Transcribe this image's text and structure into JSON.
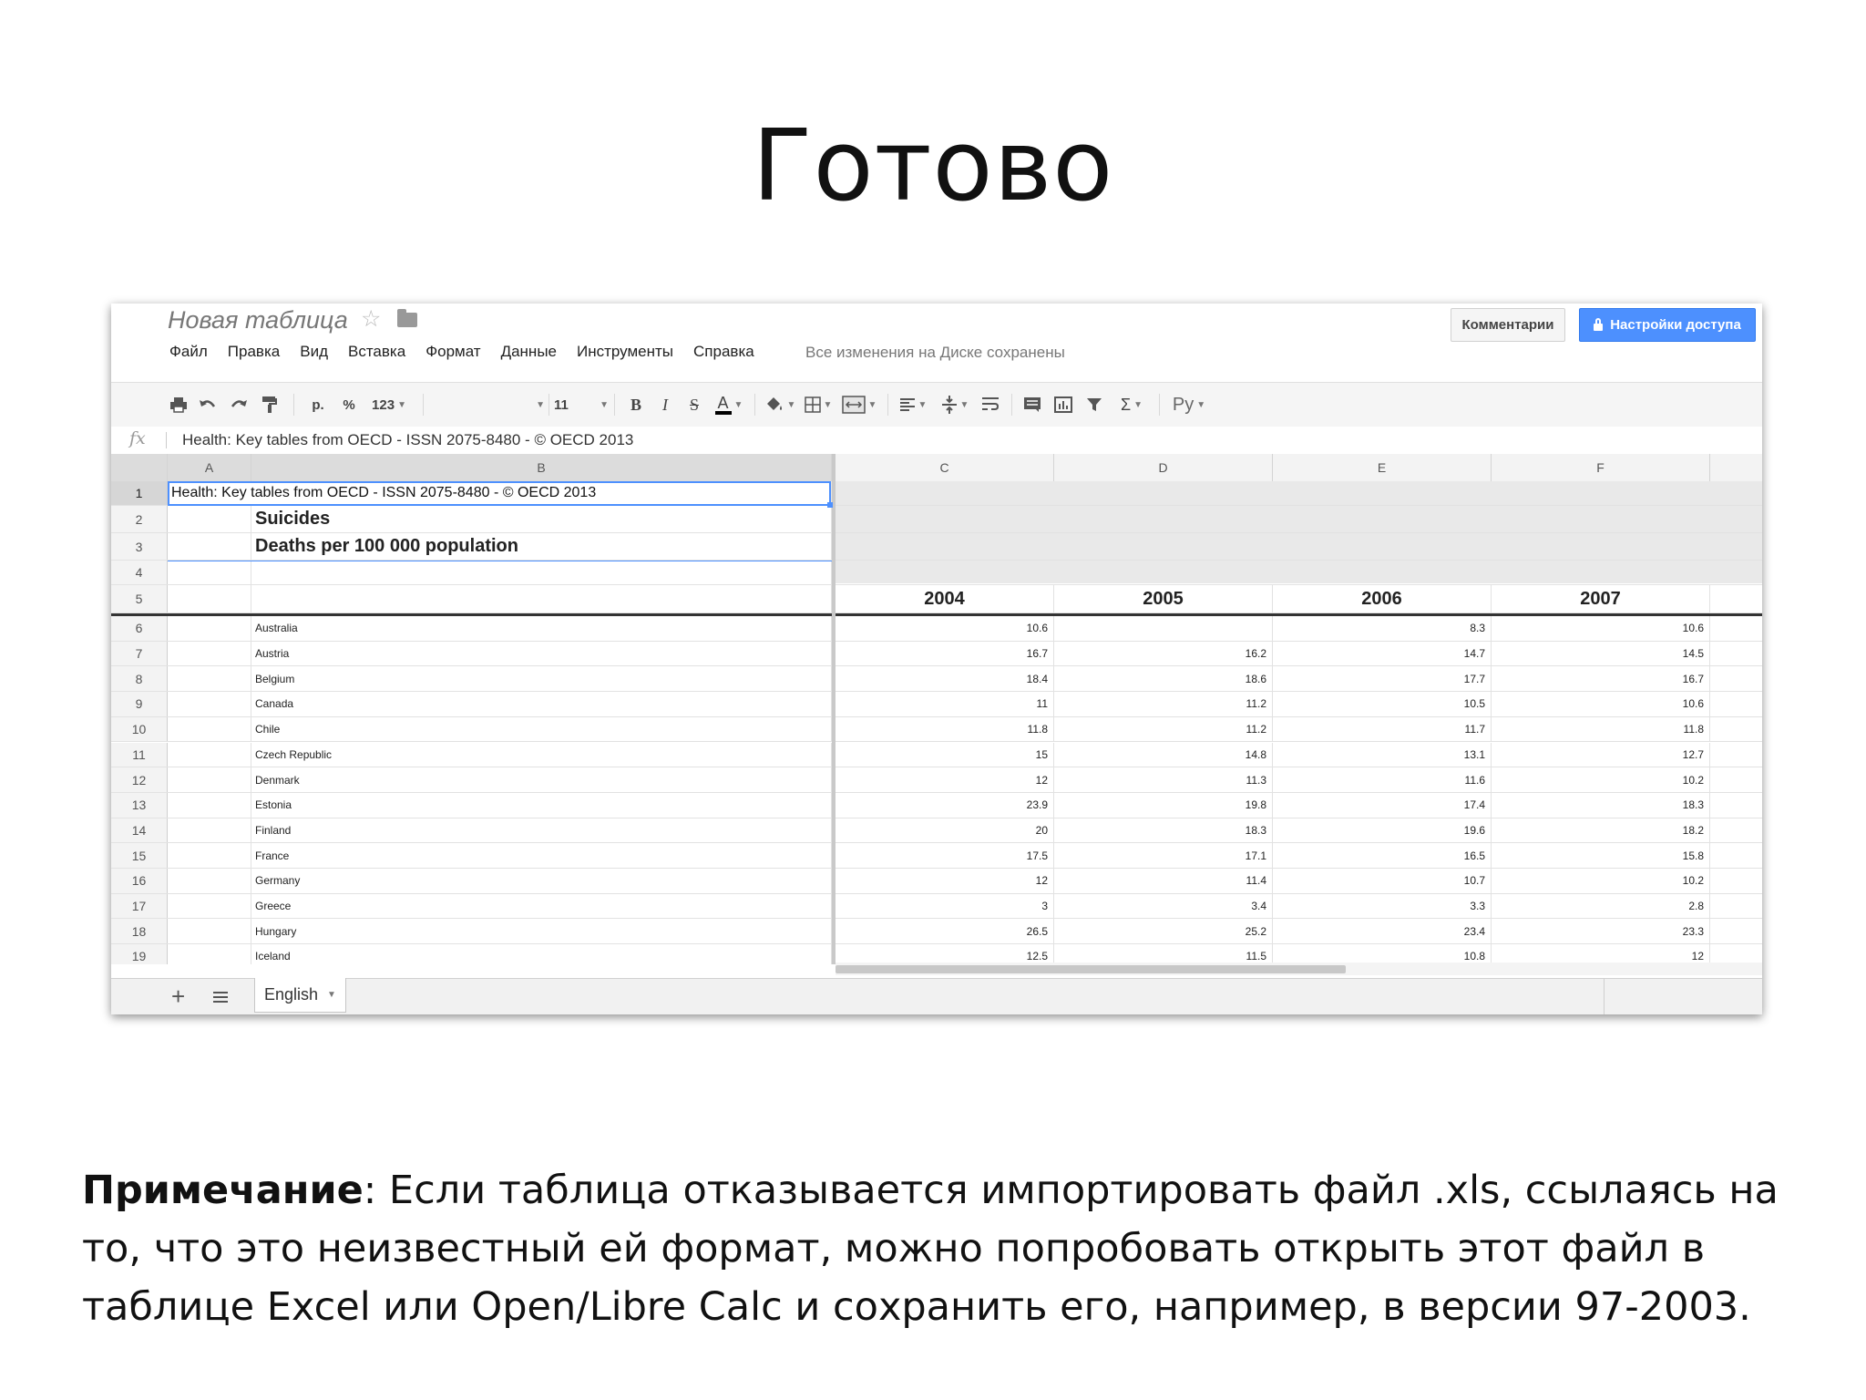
{
  "slide": {
    "title": "Готово",
    "note_label": "Примечание",
    "note_text": ": Если таблица отказывается импортировать файл .xls, ссылаясь на то, что это неизвестный ей формат, можно попробовать открыть этот файл в таблице Excel или Open/Libre Calc и сохранить его, например, в версии 97-2003."
  },
  "app": {
    "doc_title": "Новая таблица",
    "menu": [
      "Файл",
      "Правка",
      "Вид",
      "Вставка",
      "Формат",
      "Данные",
      "Инструменты",
      "Справка"
    ],
    "saved_status": "Все изменения на Диске сохранены",
    "comments_label": "Комментарии",
    "share_label": "Настройки доступа",
    "accent_color": "#4d90fe"
  },
  "toolbar": {
    "currency_label": "р.",
    "percent_label": "%",
    "number_format_label": "123",
    "font_size": "11",
    "bold_label": "B",
    "italic_label": "I",
    "strike_label": "S",
    "text_color_label": "A",
    "input_tools_label": "Ру",
    "sum_label": "Σ"
  },
  "formula_bar": {
    "fx_label": "fx",
    "content": "Health: Key tables from OECD - ISSN 2075-8480 - © OECD 2013"
  },
  "grid": {
    "columns": [
      "A",
      "B",
      "C",
      "D",
      "E",
      "F"
    ],
    "cell_a1": "Health: Key tables from OECD - ISSN 2075-8480 - © OECD 2013",
    "title_b2": "Suicides",
    "subtitle_b3": "Deaths per 100 000 population",
    "years": [
      "2004",
      "2005",
      "2006",
      "2007"
    ],
    "rows": [
      {
        "n": "6",
        "country": "Australia",
        "c": "10.6",
        "d": "",
        "e": "8.3",
        "f": "10.6"
      },
      {
        "n": "7",
        "country": "Austria",
        "c": "16.7",
        "d": "16.2",
        "e": "14.7",
        "f": "14.5"
      },
      {
        "n": "8",
        "country": "Belgium",
        "c": "18.4",
        "d": "18.6",
        "e": "17.7",
        "f": "16.7"
      },
      {
        "n": "9",
        "country": "Canada",
        "c": "11",
        "d": "11.2",
        "e": "10.5",
        "f": "10.6"
      },
      {
        "n": "10",
        "country": "Chile",
        "c": "11.8",
        "d": "11.2",
        "e": "11.7",
        "f": "11.8"
      },
      {
        "n": "11",
        "country": "Czech Republic",
        "c": "15",
        "d": "14.8",
        "e": "13.1",
        "f": "12.7"
      },
      {
        "n": "12",
        "country": "Denmark",
        "c": "12",
        "d": "11.3",
        "e": "11.6",
        "f": "10.2"
      },
      {
        "n": "13",
        "country": "Estonia",
        "c": "23.9",
        "d": "19.8",
        "e": "17.4",
        "f": "18.3"
      },
      {
        "n": "14",
        "country": "Finland",
        "c": "20",
        "d": "18.3",
        "e": "19.6",
        "f": "18.2"
      },
      {
        "n": "15",
        "country": "France",
        "c": "17.5",
        "d": "17.1",
        "e": "16.5",
        "f": "15.8"
      },
      {
        "n": "16",
        "country": "Germany",
        "c": "12",
        "d": "11.4",
        "e": "10.7",
        "f": "10.2"
      },
      {
        "n": "17",
        "country": "Greece",
        "c": "3",
        "d": "3.4",
        "e": "3.3",
        "f": "2.8"
      },
      {
        "n": "18",
        "country": "Hungary",
        "c": "26.5",
        "d": "25.2",
        "e": "23.4",
        "f": "23.3"
      },
      {
        "n": "19",
        "country": "Iceland",
        "c": "12.5",
        "d": "11.5",
        "e": "10.8",
        "f": "12"
      }
    ]
  },
  "sheets": {
    "active": "English"
  }
}
